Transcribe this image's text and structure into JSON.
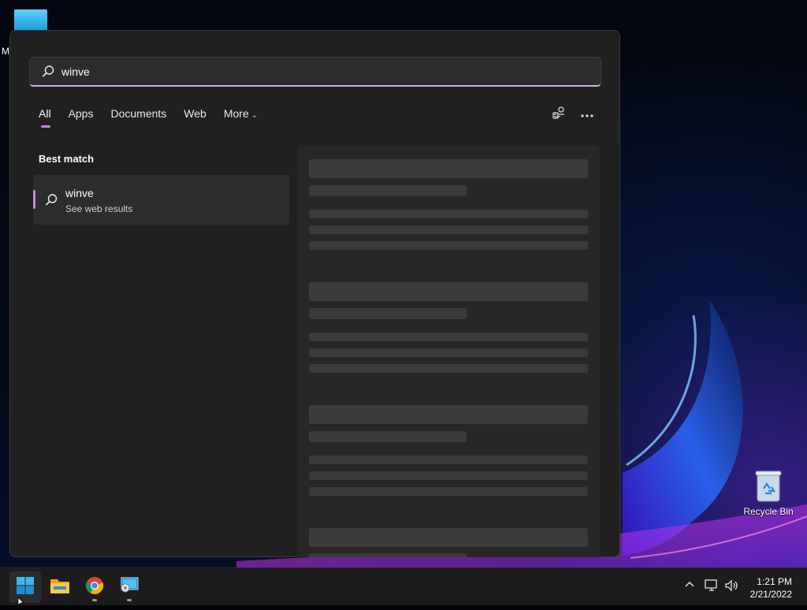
{
  "desktop": {
    "top_icon_partial_letter": "M",
    "recycle_bin_label": "Recycle Bin"
  },
  "search": {
    "value": "winve",
    "placeholder": ""
  },
  "tabs": [
    {
      "label": "All",
      "active": true
    },
    {
      "label": "Apps"
    },
    {
      "label": "Documents"
    },
    {
      "label": "Web"
    },
    {
      "label": "More"
    }
  ],
  "toolbar_icons": [
    "accounts-switch-icon",
    "more-options-icon"
  ],
  "results": {
    "section_title": "Best match",
    "best_match": {
      "title": "winve",
      "subtitle": "See web results"
    }
  },
  "taskbar": {
    "pinned": [
      "windows-start-icon",
      "file-explorer-icon",
      "chrome-icon",
      "control-panel-icon"
    ],
    "tray_icons": [
      "chevron-up-icon",
      "network-icon",
      "volume-icon"
    ],
    "time": "1:21 PM",
    "date": "2/21/2022"
  },
  "colors": {
    "accent": "#c58ad8",
    "panel_bg": "#202020",
    "taskbar_bg": "#1c1c1c"
  }
}
